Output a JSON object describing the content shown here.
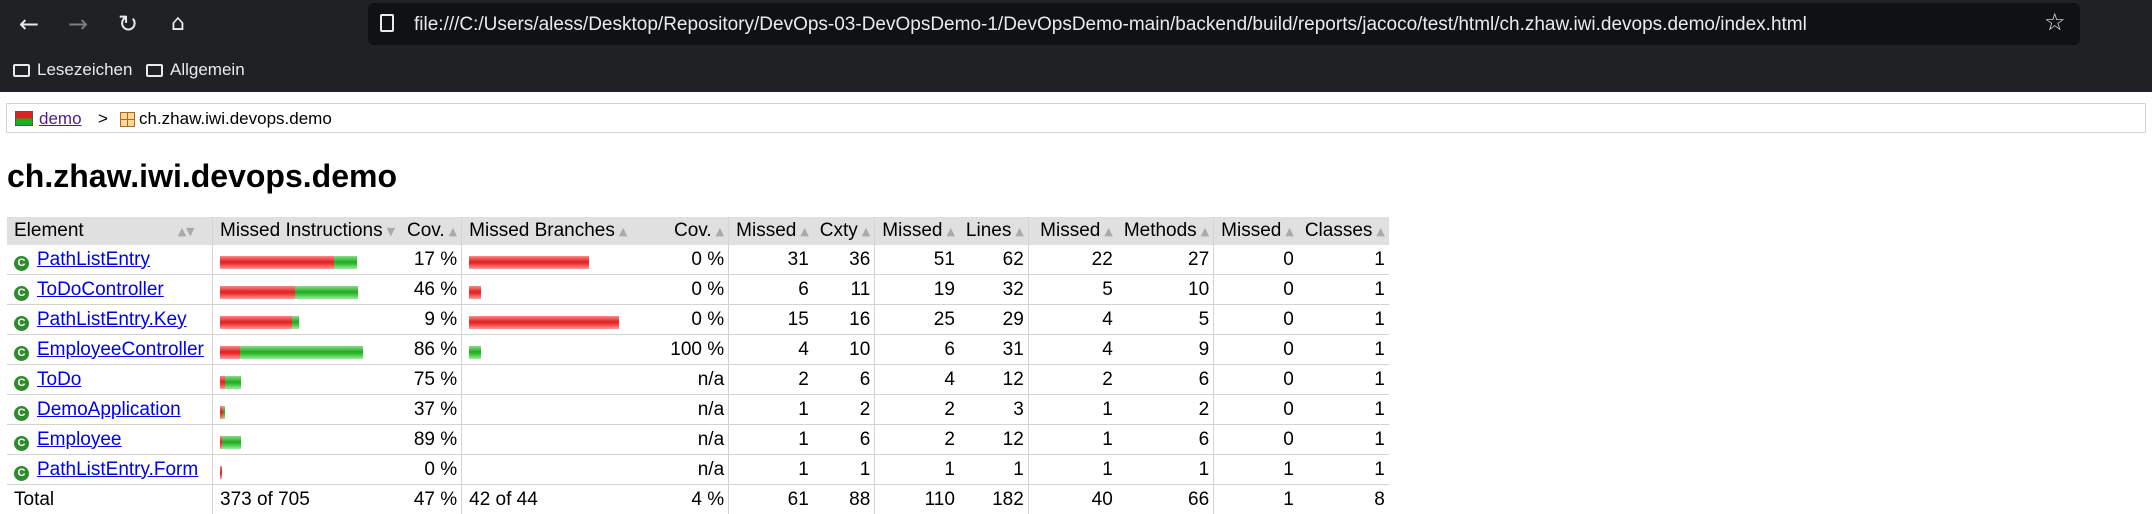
{
  "browser": {
    "url": "file:///C:/Users/aless/Desktop/Repository/DevOps-03-DevOpsDemo-1/DevOpsDemo-main/backend/build/reports/jacoco/test/html/ch.zhaw.iwi.devops.demo/index.html",
    "nav_icons": [
      "back-arrow-icon",
      "forward-arrow-icon",
      "reload-icon",
      "home-icon"
    ],
    "bookmarks": [
      "Lesezeichen",
      "Allgemein"
    ]
  },
  "breadcrumb": {
    "link": "demo",
    "separator": ">",
    "current": "ch.zhaw.iwi.devops.demo"
  },
  "page_title": "ch.zhaw.iwi.devops.demo",
  "colors": {
    "missed": "#dd2222",
    "covered": "#22aa22",
    "header_bg": "#e0e0e0",
    "link": "#0000ee"
  },
  "table": {
    "headers": [
      "Element",
      "Missed Instructions",
      "Cov.",
      "Missed Branches",
      "Cov.",
      "Missed",
      "Cxty",
      "Missed",
      "Lines",
      "Missed",
      "Methods",
      "Missed",
      "Classes"
    ],
    "rows": [
      {
        "name": "PathListEntry",
        "instr_bar": {
          "missed": 0.38,
          "covered": 0.077
        },
        "instr_cov": "17 %",
        "branch_bar": {
          "missed": 0.4,
          "covered": 0
        },
        "branch_cov": "0 %",
        "cxty_missed": "31",
        "cxty": "36",
        "lines_missed": "51",
        "lines": "62",
        "methods_missed": "22",
        "methods": "27",
        "classes_missed": "0",
        "classes": "1"
      },
      {
        "name": "ToDoController",
        "instr_bar": {
          "missed": 0.25,
          "covered": 0.21
        },
        "instr_cov": "46 %",
        "branch_bar": {
          "missed": 0.04,
          "covered": 0
        },
        "branch_cov": "0 %",
        "cxty_missed": "6",
        "cxty": "11",
        "lines_missed": "19",
        "lines": "32",
        "methods_missed": "5",
        "methods": "10",
        "classes_missed": "0",
        "classes": "1"
      },
      {
        "name": "PathListEntry.Key",
        "instr_bar": {
          "missed": 0.24,
          "covered": 0.024
        },
        "instr_cov": "9 %",
        "branch_bar": {
          "missed": 0.5,
          "covered": 0
        },
        "branch_cov": "0 %",
        "cxty_missed": "15",
        "cxty": "16",
        "lines_missed": "25",
        "lines": "29",
        "methods_missed": "4",
        "methods": "5",
        "classes_missed": "0",
        "classes": "1"
      },
      {
        "name": "EmployeeController",
        "instr_bar": {
          "missed": 0.067,
          "covered": 0.41
        },
        "instr_cov": "86 %",
        "branch_bar": {
          "missed": 0,
          "covered": 0.04
        },
        "branch_cov": "100 %",
        "cxty_missed": "4",
        "cxty": "10",
        "lines_missed": "6",
        "lines": "31",
        "methods_missed": "4",
        "methods": "9",
        "classes_missed": "0",
        "classes": "1"
      },
      {
        "name": "ToDo",
        "instr_bar": {
          "missed": 0.018,
          "covered": 0.053
        },
        "instr_cov": "75 %",
        "branch_bar": {
          "missed": 0,
          "covered": 0
        },
        "branch_cov": "n/a",
        "cxty_missed": "2",
        "cxty": "6",
        "lines_missed": "4",
        "lines": "12",
        "methods_missed": "2",
        "methods": "6",
        "classes_missed": "0",
        "classes": "1"
      },
      {
        "name": "DemoApplication",
        "instr_bar": {
          "missed": 0.011,
          "covered": 0.007
        },
        "instr_cov": "37 %",
        "branch_bar": {
          "missed": 0,
          "covered": 0
        },
        "branch_cov": "n/a",
        "cxty_missed": "1",
        "cxty": "2",
        "lines_missed": "2",
        "lines": "3",
        "methods_missed": "1",
        "methods": "2",
        "classes_missed": "0",
        "classes": "1"
      },
      {
        "name": "Employee",
        "instr_bar": {
          "missed": 0.008,
          "covered": 0.064
        },
        "instr_cov": "89 %",
        "branch_bar": {
          "missed": 0,
          "covered": 0
        },
        "branch_cov": "n/a",
        "cxty_missed": "1",
        "cxty": "6",
        "lines_missed": "2",
        "lines": "12",
        "methods_missed": "1",
        "methods": "6",
        "classes_missed": "0",
        "classes": "1"
      },
      {
        "name": "PathListEntry.Form",
        "instr_bar": {
          "missed": 0.006,
          "covered": 0
        },
        "instr_cov": "0 %",
        "branch_bar": {
          "missed": 0,
          "covered": 0
        },
        "branch_cov": "n/a",
        "cxty_missed": "1",
        "cxty": "1",
        "lines_missed": "1",
        "lines": "1",
        "methods_missed": "1",
        "methods": "1",
        "classes_missed": "1",
        "classes": "1"
      }
    ],
    "total": {
      "label": "Total",
      "instr": "373 of 705",
      "instr_cov": "47 %",
      "branch": "42 of 44",
      "branch_cov": "4 %",
      "cxty_missed": "61",
      "cxty": "88",
      "lines_missed": "110",
      "lines": "182",
      "methods_missed": "40",
      "methods": "66",
      "classes_missed": "1",
      "classes": "8"
    }
  }
}
